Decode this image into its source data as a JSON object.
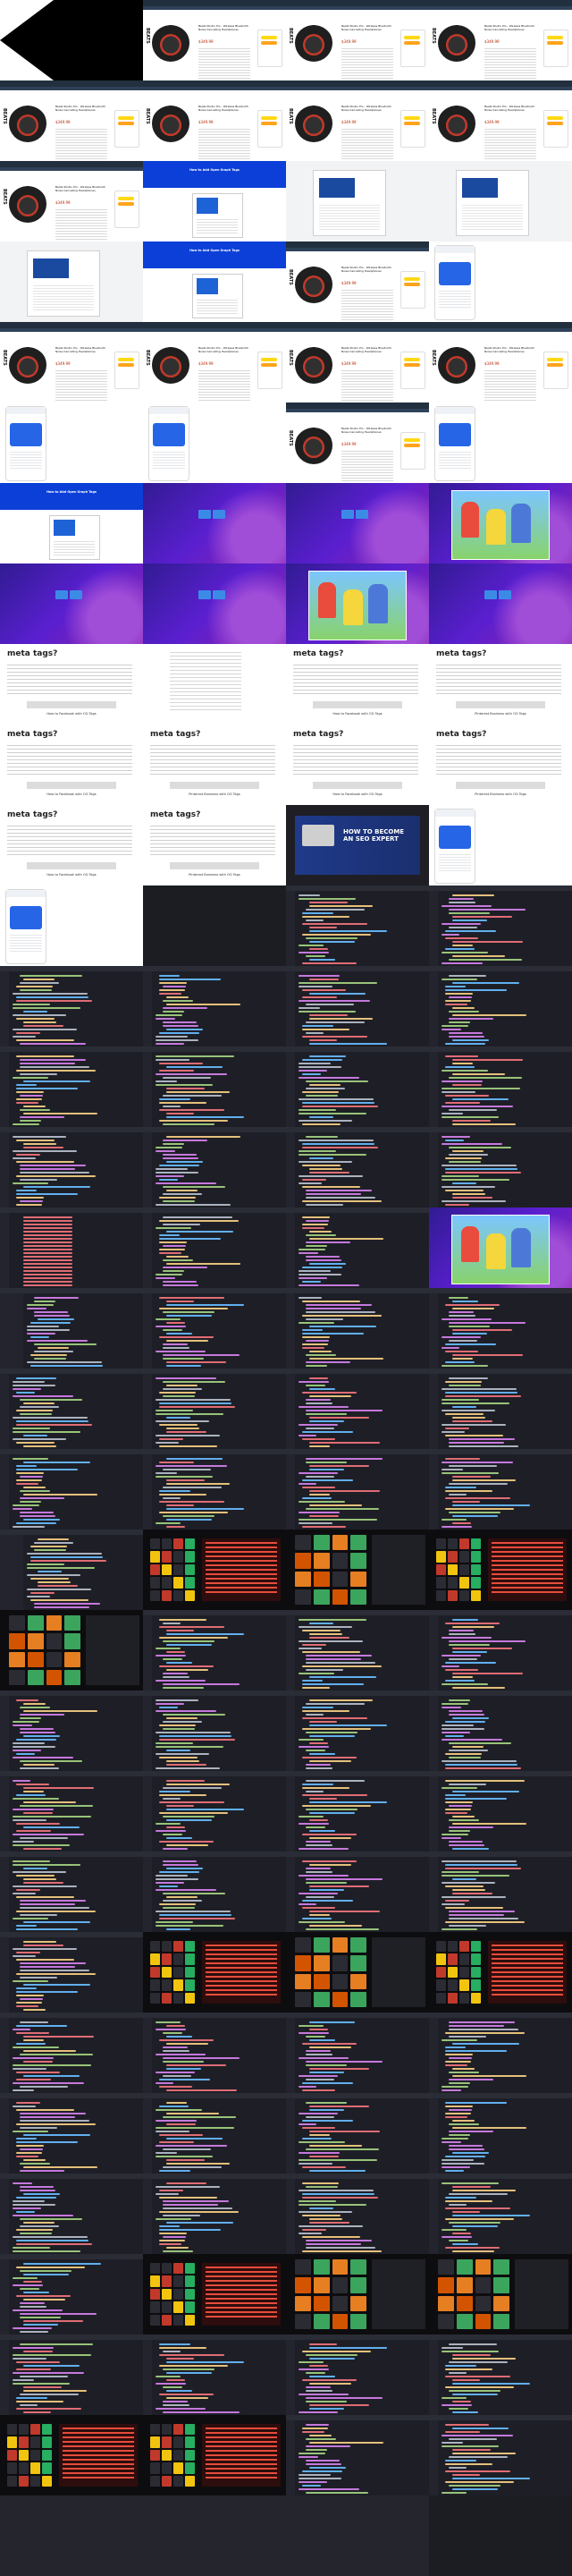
{
  "meta_tags_heading": "meta tags?",
  "caption_facebook": "How to Facebook with OG Tags",
  "caption_twitter": "Pinterest Business with OG Tags",
  "seo_banner_text": "HOW TO BECOME AN SEO EXPERT",
  "product_brand": "BEATS",
  "product_price": "$349.99",
  "product_title_snippet": "Beats Studio Pro - Wireless Bluetooth Noise Cancelling Headphones",
  "fb_hero_text": "How to Add Open Graph Tags",
  "fb_hero_text_2": "Facebook Open Graph Tags",
  "colors": {
    "editor_bg": "#1e1f26",
    "amazon_bar": "#222f3e",
    "fb_blue": "#0b3fd8",
    "wallpaper_purple": "#5a1fd0"
  }
}
